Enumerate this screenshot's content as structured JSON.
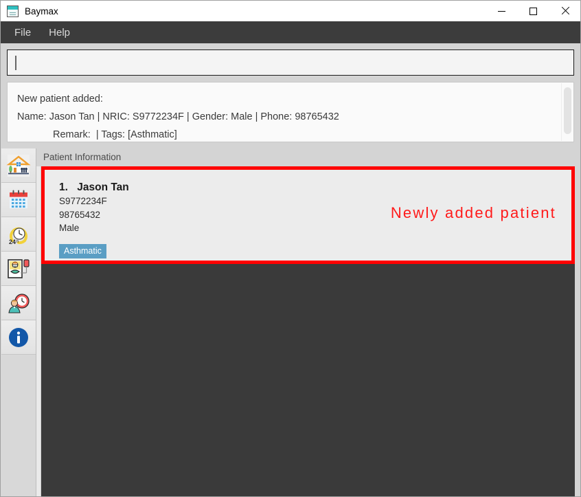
{
  "window": {
    "title": "Baymax",
    "app_icon": "calendar-app-icon",
    "controls": {
      "minimize": "minimize-icon",
      "maximize": "maximize-icon",
      "close": "close-icon"
    }
  },
  "menubar": {
    "items": [
      {
        "label": "File"
      },
      {
        "label": "Help"
      }
    ]
  },
  "command_input": {
    "value": "",
    "placeholder": ""
  },
  "result_display": {
    "lines": [
      "New patient added:",
      "Name: Jason Tan | NRIC: S9772234F | Gender: Male | Phone: 98765432",
      "Remark:  | Tags: [Asthmatic]"
    ],
    "indent_line_index": 2
  },
  "sidebar": {
    "items": [
      {
        "name": "home",
        "icon": "house-icon"
      },
      {
        "name": "calendar",
        "icon": "calendar-icon"
      },
      {
        "name": "schedule-24h",
        "icon": "clock-24h-icon"
      },
      {
        "name": "patients",
        "icon": "patient-iv-drip-icon"
      },
      {
        "name": "appointments",
        "icon": "person-clock-icon"
      },
      {
        "name": "info",
        "icon": "info-circle-icon"
      }
    ]
  },
  "panel": {
    "title": "Patient Information"
  },
  "patient_list": [
    {
      "index": "1.",
      "name": "Jason Tan",
      "nric": "S9772234F",
      "phone": "98765432",
      "gender": "Male",
      "tags": [
        "Asthmatic"
      ]
    }
  ],
  "annotation": {
    "text": "Newly added patient",
    "color": "#ff1a1a"
  },
  "colors": {
    "highlight_box": "#ff0000",
    "tag_chip": "#5a9ec4",
    "menubar_bg": "#3c3c3c",
    "dark_panel": "#3a3a3a",
    "card_bg": "#ececec"
  }
}
